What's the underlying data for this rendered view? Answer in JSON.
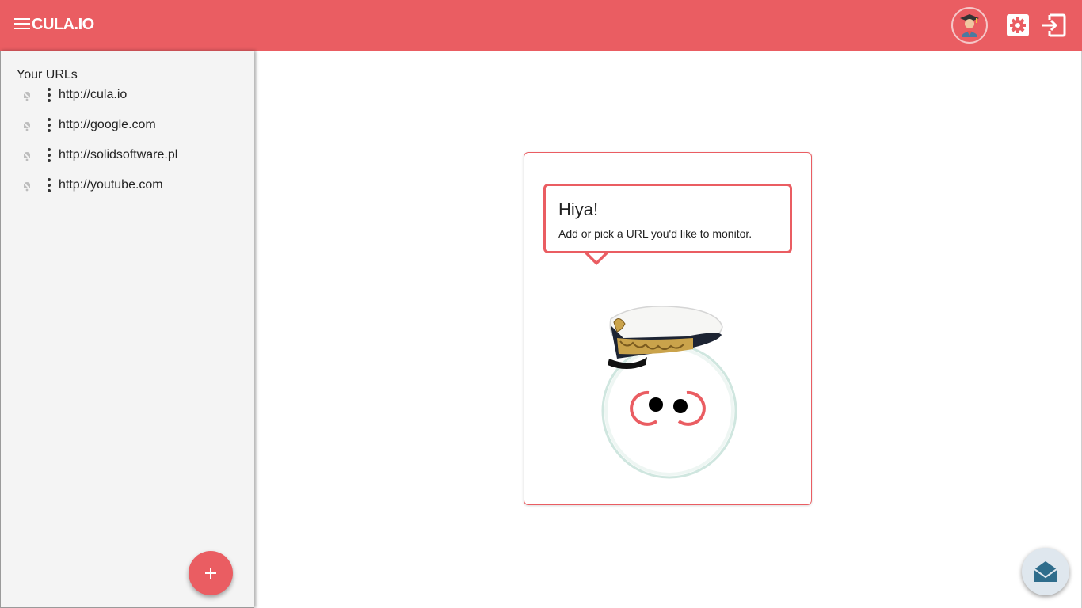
{
  "header": {
    "brand": "CULA.IO",
    "menu_icon": "hamburger-icon",
    "avatar_icon": "graduate-avatar-icon",
    "settings_icon": "gear-icon",
    "logout_icon": "logout-icon"
  },
  "sidebar": {
    "title": "Your URLs",
    "urls": [
      {
        "label": "http://cula.io",
        "icon": "bell-muted-icon"
      },
      {
        "label": "http://google.com",
        "icon": "bell-muted-icon"
      },
      {
        "label": "http://solidsoftware.pl",
        "icon": "bell-muted-icon"
      },
      {
        "label": "http://youtube.com",
        "icon": "bell-muted-icon"
      }
    ],
    "add_icon": "plus-icon"
  },
  "welcome": {
    "title": "Hiya!",
    "message": "Add or pick a URL you'd like to monitor.",
    "mascot_icon": "captain-mascot-icon"
  },
  "support": {
    "icon": "mail-icon"
  },
  "colors": {
    "brand": "#ea5d62",
    "sidebar_bg": "#f4f4f4",
    "mail_icon": "#2f6d8c"
  }
}
